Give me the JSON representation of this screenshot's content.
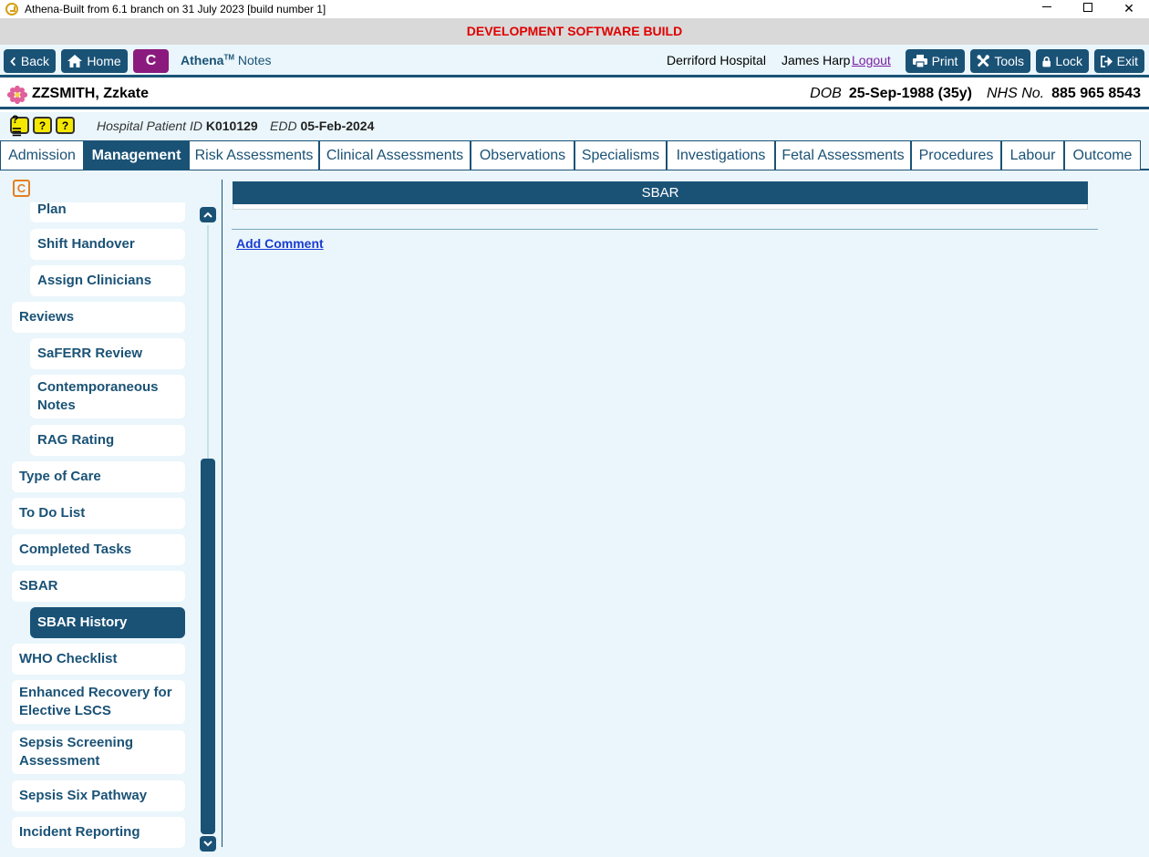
{
  "window": {
    "title": "Athena-Built from 6.1 branch on 31 July 2023 [build number 1]",
    "controls": [
      "minimize",
      "maximize",
      "close"
    ]
  },
  "banner": "DEVELOPMENT SOFTWARE BUILD",
  "toolbar": {
    "back_label": "Back",
    "home_label": "Home",
    "c_label": "C",
    "app_name": "Athena",
    "app_tm": "TM",
    "app_section": "Notes",
    "hospital": "Derriford Hospital",
    "user": "James Harp",
    "logout_label": "Logout",
    "print_label": "Print",
    "tools_label": "Tools",
    "lock_label": "Lock",
    "exit_label": "Exit"
  },
  "patient": {
    "name": "ZZSMITH, Zzkate",
    "dob_label": "DOB",
    "dob_value": "25-Sep-1988 (35y)",
    "nhs_label": "NHS No.",
    "nhs_value": "885 965 8543",
    "hospital_id_label": "Hospital Patient ID",
    "hospital_id_value": "K010129",
    "edd_label": "EDD",
    "edd_value": "05-Feb-2024",
    "alert_icons": [
      "?☰",
      "?",
      "?"
    ]
  },
  "tabs": [
    {
      "label": "Admission"
    },
    {
      "label": "Management",
      "active": true
    },
    {
      "label": "Risk Assessments"
    },
    {
      "label": "Clinical Assessments"
    },
    {
      "label": "Observations"
    },
    {
      "label": "Specialisms"
    },
    {
      "label": "Investigations"
    },
    {
      "label": "Fetal Assessments"
    },
    {
      "label": "Procedures"
    },
    {
      "label": "Labour"
    },
    {
      "label": "Outcome"
    }
  ],
  "sidebar": {
    "c_icon": "C",
    "items": [
      {
        "label": "Plan",
        "sub": true
      },
      {
        "label": "Shift Handover",
        "sub": true
      },
      {
        "label": "Assign Clinicians",
        "sub": true
      },
      {
        "label": "Reviews",
        "sub": false
      },
      {
        "label": "SaFERR Review",
        "sub": true
      },
      {
        "label": "Contemporaneous Notes",
        "sub": true
      },
      {
        "label": "RAG Rating",
        "sub": true
      },
      {
        "label": "Type of Care",
        "sub": false
      },
      {
        "label": "To Do List",
        "sub": false
      },
      {
        "label": "Completed Tasks",
        "sub": false
      },
      {
        "label": "SBAR",
        "sub": false
      },
      {
        "label": "SBAR History",
        "sub": true,
        "active": true
      },
      {
        "label": "WHO Checklist",
        "sub": false
      },
      {
        "label": "Enhanced Recovery for Elective LSCS",
        "sub": false
      },
      {
        "label": "Sepsis Screening Assessment",
        "sub": false
      },
      {
        "label": "Sepsis Six Pathway",
        "sub": false
      },
      {
        "label": "Incident Reporting",
        "sub": false
      }
    ]
  },
  "content": {
    "section_title": "SBAR",
    "add_comment_label": "Add Comment"
  },
  "colors": {
    "primary": "#1a5276",
    "banner_text": "#e00000",
    "c_button": "#8b1a7e",
    "background": "#eaf6fb",
    "link": "#1a3ccf"
  }
}
